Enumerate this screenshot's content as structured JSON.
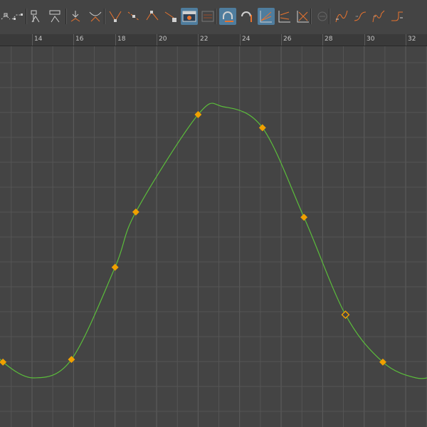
{
  "toolbar": {
    "buttons": [
      {
        "name": "move-nearest-key-tool-button",
        "icon": "dashed-keys-icon",
        "active": false
      },
      {
        "name": "insert-keys-tool-button",
        "icon": "dashed-keys-insert-icon",
        "active": false
      },
      {
        "name": "lattice-deform-keys-button",
        "icon": "lattice-keys-icon",
        "active": false
      },
      {
        "name": "region-scale-keys-button",
        "icon": "region-keys-icon",
        "active": false
      },
      {
        "name": "set-key-button",
        "icon": "key-down-icon",
        "active": false
      },
      {
        "name": "break-key-button",
        "icon": "break-key-icon",
        "active": false
      },
      {
        "name": "spline-tangents-button",
        "icon": "spline-tangent-icon",
        "active": false
      },
      {
        "name": "linear-tangents-button",
        "icon": "linear-tangent-icon",
        "active": false
      },
      {
        "name": "flat-tangents-button",
        "icon": "flat-tangent-icon",
        "active": false
      },
      {
        "name": "lock-tangent-button",
        "icon": "lock-tangent-icon",
        "active": false
      },
      {
        "name": "buffer-curve-snapshot-button",
        "icon": "buffer-curve-icon",
        "active": true
      },
      {
        "name": "swap-buffer-curve-button",
        "icon": "swap-buffer-icon",
        "active": false
      },
      {
        "name": "auto-frame-button",
        "icon": "magnet-frame-icon",
        "active": true
      },
      {
        "name": "snap-values-button",
        "icon": "magnet-value-icon",
        "active": false
      },
      {
        "name": "normalize-curves-button",
        "icon": "normalize-icon",
        "active": true
      },
      {
        "name": "denormalize-curves-button",
        "icon": "denormalize-icon",
        "active": false
      },
      {
        "name": "stacked-curves-button",
        "icon": "stacked-curves-icon",
        "active": false
      },
      {
        "name": "pre-infinity-button",
        "icon": "infinity-icon",
        "active": false
      },
      {
        "name": "cycle-button",
        "icon": "cycle-curve-icon",
        "active": false
      },
      {
        "name": "cycle-offset-button",
        "icon": "cycle-offset-icon",
        "active": false
      },
      {
        "name": "oscillate-button",
        "icon": "oscillate-icon",
        "active": false
      },
      {
        "name": "post-infinity-button",
        "icon": "post-infinity-icon",
        "active": false
      }
    ]
  },
  "ruler": {
    "labels": [
      "14",
      "16",
      "18",
      "20",
      "22",
      "24",
      "26",
      "28",
      "30",
      "32"
    ]
  },
  "colors": {
    "background": "#444444",
    "grid": "#555555",
    "gridMajor": "#5e5e5e",
    "curve": "#5bbd3b",
    "key": "#f0a000",
    "icon": "#d0d0d0",
    "iconAccent": "#e8732e",
    "active": "#4f7d9e"
  },
  "curve": {
    "keys": [
      {
        "frame": 12.6,
        "value": 0.06
      },
      {
        "frame": 15.9,
        "value": 0.07
      },
      {
        "frame": 18.0,
        "value": 0.42
      },
      {
        "frame": 19.0,
        "value": 0.63
      },
      {
        "frame": 22.0,
        "value": 1.0
      },
      {
        "frame": 25.1,
        "value": 0.95
      },
      {
        "frame": 27.1,
        "value": 0.61
      },
      {
        "frame": 29.1,
        "value": 0.24,
        "selected": true
      },
      {
        "frame": 30.9,
        "value": 0.06
      }
    ],
    "frameRange": [
      12.6,
      33.3
    ],
    "extremes": {
      "low": {
        "frame": 14.1,
        "value": 0.0
      },
      "high": {
        "frame": 23.2,
        "value": 1.03
      }
    }
  }
}
